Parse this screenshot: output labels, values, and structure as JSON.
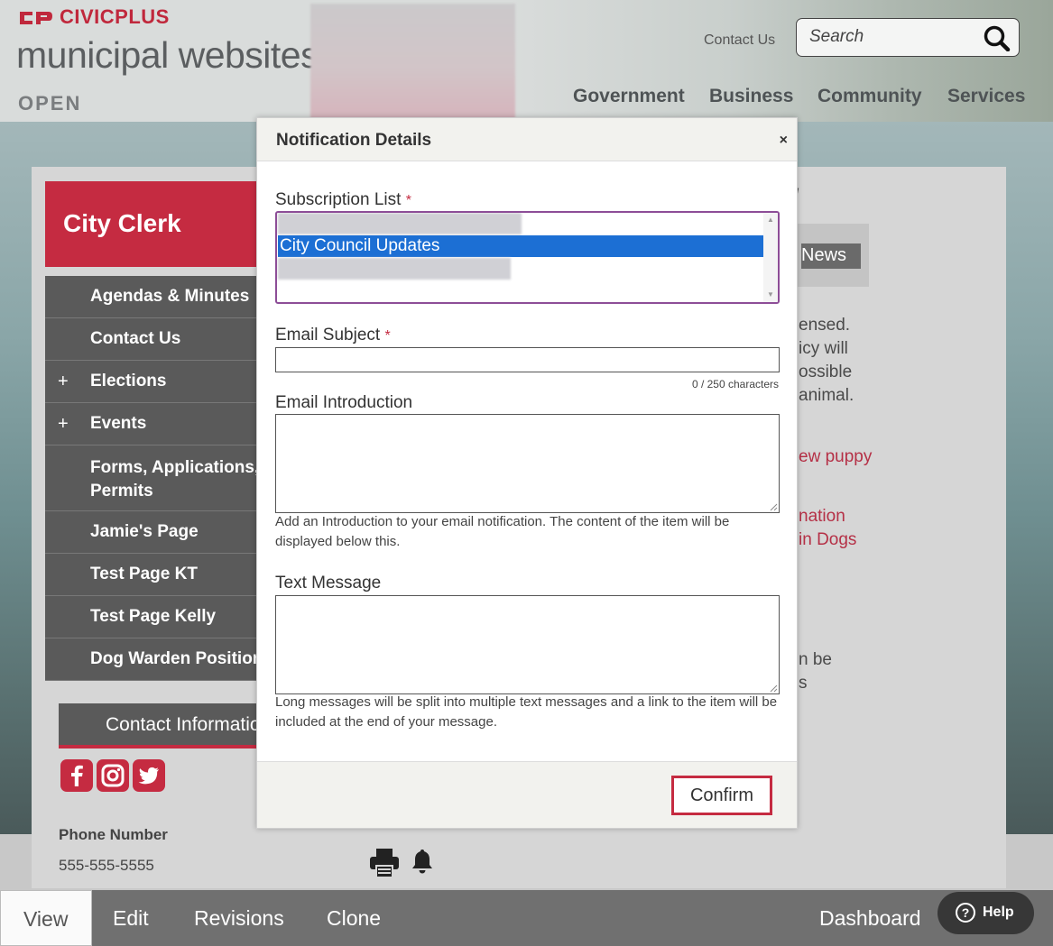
{
  "header": {
    "brand": "CIVICPLUS",
    "subtitle": "municipal websites",
    "status": "OPEN",
    "contact_link": "Contact Us",
    "search_placeholder": "Search",
    "nav": [
      "Government",
      "Business",
      "Community",
      "Services"
    ]
  },
  "sidebar": {
    "title": "City Clerk",
    "items": [
      {
        "label": "Agendas & Minutes",
        "expandable": false
      },
      {
        "label": "Contact Us",
        "expandable": false
      },
      {
        "label": "Elections",
        "expandable": true
      },
      {
        "label": "Events",
        "expandable": true
      },
      {
        "label": "Forms, Applications, Permits",
        "line1": "Forms, Applications,",
        "line2": "Permits",
        "expandable": false
      },
      {
        "label": "Jamie's Page",
        "expandable": false
      },
      {
        "label": "Test Page KT",
        "expandable": false
      },
      {
        "label": "Test Page Kelly",
        "expandable": false
      },
      {
        "label": "Dog Warden Position",
        "expandable": false
      }
    ],
    "plus_symbol": "+",
    "contact_header": "Contact Information",
    "phone_label": "Phone Number",
    "phone_value": "555-555-5555"
  },
  "main_fragments": {
    "news_button": "News",
    "lines": [
      "ensed.",
      "icy will",
      "ossible",
      "animal.",
      "ew puppy",
      "nation",
      "in Dogs",
      "n be",
      "s"
    ]
  },
  "modal": {
    "title": "Notification Details",
    "close": "×",
    "subscription_label": "Subscription List",
    "required_mark": "*",
    "subscription_selected": "City Council Updates",
    "email_subject_label": "Email Subject",
    "email_subject_value": "",
    "char_count": "0 / 250 characters",
    "email_intro_label": "Email Introduction",
    "email_intro_help": "Add an Introduction to your email notification. The content of the item will be displayed below this.",
    "text_message_label": "Text Message",
    "text_message_help": "Long messages will be split into multiple text messages and a link to the item will be included at the end of your message.",
    "confirm_label": "Confirm"
  },
  "toolbar": {
    "tabs": [
      "View",
      "Edit",
      "Revisions",
      "Clone"
    ],
    "active_tab": "View",
    "dashboard": "Dashboard",
    "help": "Help"
  },
  "colors": {
    "brand_red": "#c52b41",
    "selection_blue": "#1c6fd4",
    "focus_purple": "#8d4d97"
  }
}
